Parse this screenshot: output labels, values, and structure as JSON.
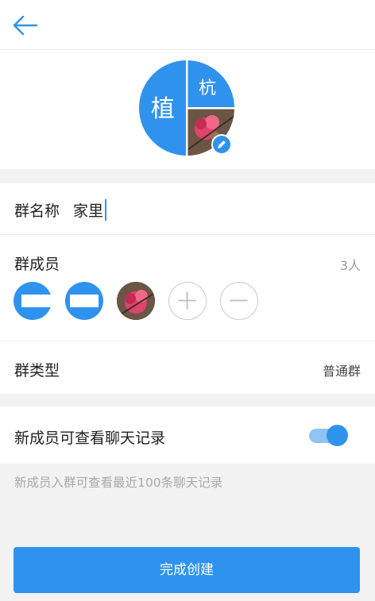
{
  "header": {
    "back_icon": "arrow-left-icon"
  },
  "group_avatar": {
    "left_char": "植",
    "right_top_char": "杭",
    "edit_icon": "pencil-icon",
    "accent_color": "#2f93ee"
  },
  "group_name": {
    "label": "群名称",
    "value": "家里"
  },
  "members": {
    "label": "群成员",
    "count": "3人",
    "add_icon": "plus-icon",
    "remove_icon": "minus-icon"
  },
  "group_type": {
    "label": "群类型",
    "value": "普通群"
  },
  "history": {
    "label": "新成员可查看聊天记录",
    "enabled": true,
    "hint": "新成员入群可查看最近100条聊天记录"
  },
  "submit_label": "完成创建"
}
